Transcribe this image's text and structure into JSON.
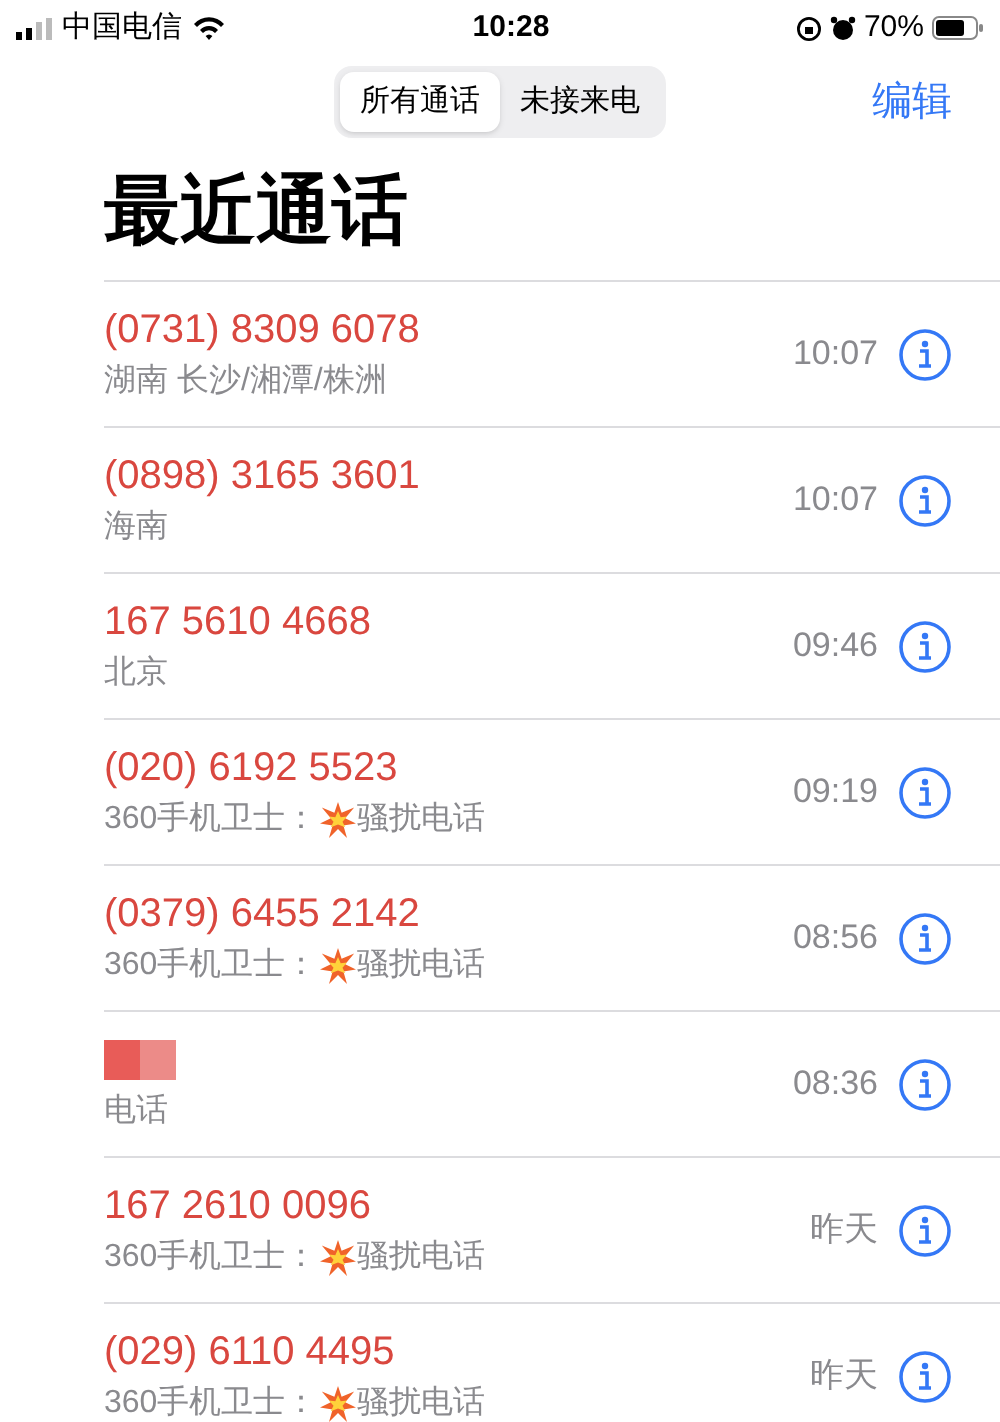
{
  "status_bar": {
    "carrier": "中国电信",
    "time": "10:28",
    "battery": "70%"
  },
  "segments": [
    {
      "label": "所有通话",
      "selected": true
    },
    {
      "label": "未接来电",
      "selected": false
    }
  ],
  "edit_button": "编辑",
  "title": "最近通话",
  "calls": [
    {
      "kind": "number",
      "number": "(0731) 8309 6078",
      "location": "湖南 长沙/湘潭/株洲",
      "time": "10:07"
    },
    {
      "kind": "number",
      "number": "(0898) 3165 3601",
      "location": "海南",
      "time": "10:07"
    },
    {
      "kind": "number",
      "number": "167 5610 4668",
      "location": "北京",
      "time": "09:46"
    },
    {
      "kind": "number",
      "number": "(020) 6192 5523",
      "source": "360手机卫士：",
      "tag": "骚扰电话",
      "time": "09:19"
    },
    {
      "kind": "number",
      "number": "(0379) 6455 2142",
      "source": "360手机卫士：",
      "tag": "骚扰电话",
      "time": "08:56"
    },
    {
      "kind": "redacted",
      "location": "电话",
      "time": "08:36"
    },
    {
      "kind": "number",
      "number": "167 2610 0096",
      "source": "360手机卫士：",
      "tag": "骚扰电话",
      "time": "昨天"
    },
    {
      "kind": "number",
      "number": "(029) 6110 4495",
      "source": "360手机卫士：",
      "tag": "骚扰电话",
      "time": "昨天"
    }
  ]
}
